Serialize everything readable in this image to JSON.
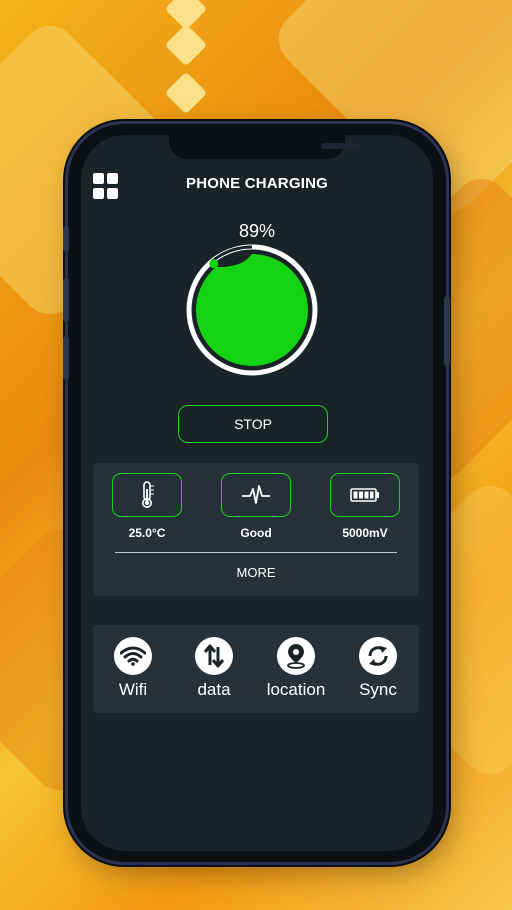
{
  "app": {
    "title": "PHONE CHARGING"
  },
  "battery": {
    "percent_label": "89%",
    "level": 0.89,
    "fill_color": "#13d313",
    "accent_color": "#1fd11b"
  },
  "controls": {
    "stop_label": "STOP"
  },
  "stats": [
    {
      "icon": "thermometer-icon",
      "label": "25.0°C"
    },
    {
      "icon": "heartbeat-icon",
      "label": "Good"
    },
    {
      "icon": "battery-icon",
      "label": "5000mV"
    }
  ],
  "stats_more_label": "MORE",
  "toggles": [
    {
      "icon": "wifi-icon",
      "label": "Wifi"
    },
    {
      "icon": "data-transfer-icon",
      "label": "data"
    },
    {
      "icon": "location-icon",
      "label": "location"
    },
    {
      "icon": "sync-icon",
      "label": "Sync"
    }
  ]
}
